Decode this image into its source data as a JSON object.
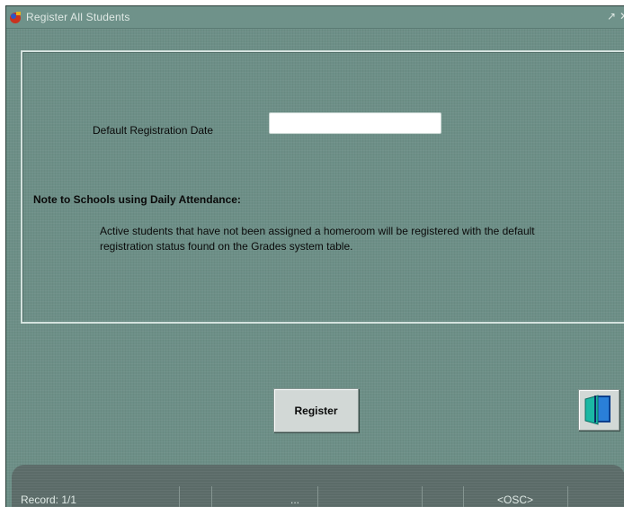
{
  "window": {
    "title": "Register All Students",
    "icons": {
      "app": "app-icon",
      "maximize": "restore-arrow-icon",
      "close": "close-icon"
    }
  },
  "form": {
    "date_label": "Default Registration Date",
    "date_value": "",
    "note_heading": "Note to Schools using Daily Attendance:",
    "note_body": "Active students that have not been assigned a homeroom will be registered with the default registration status found on the Grades system table."
  },
  "buttons": {
    "register_label": "Register",
    "exit_icon": "exit-door-icon"
  },
  "statusbar": {
    "record": "Record: 1/1",
    "ellipsis": "...",
    "mode": "<OSC>"
  },
  "colors": {
    "window_bg": "#6d8f87",
    "panel_border": "#d4e2de",
    "statusbar_bg": "#5b6b68",
    "button_bg": "#d2d8d6"
  }
}
